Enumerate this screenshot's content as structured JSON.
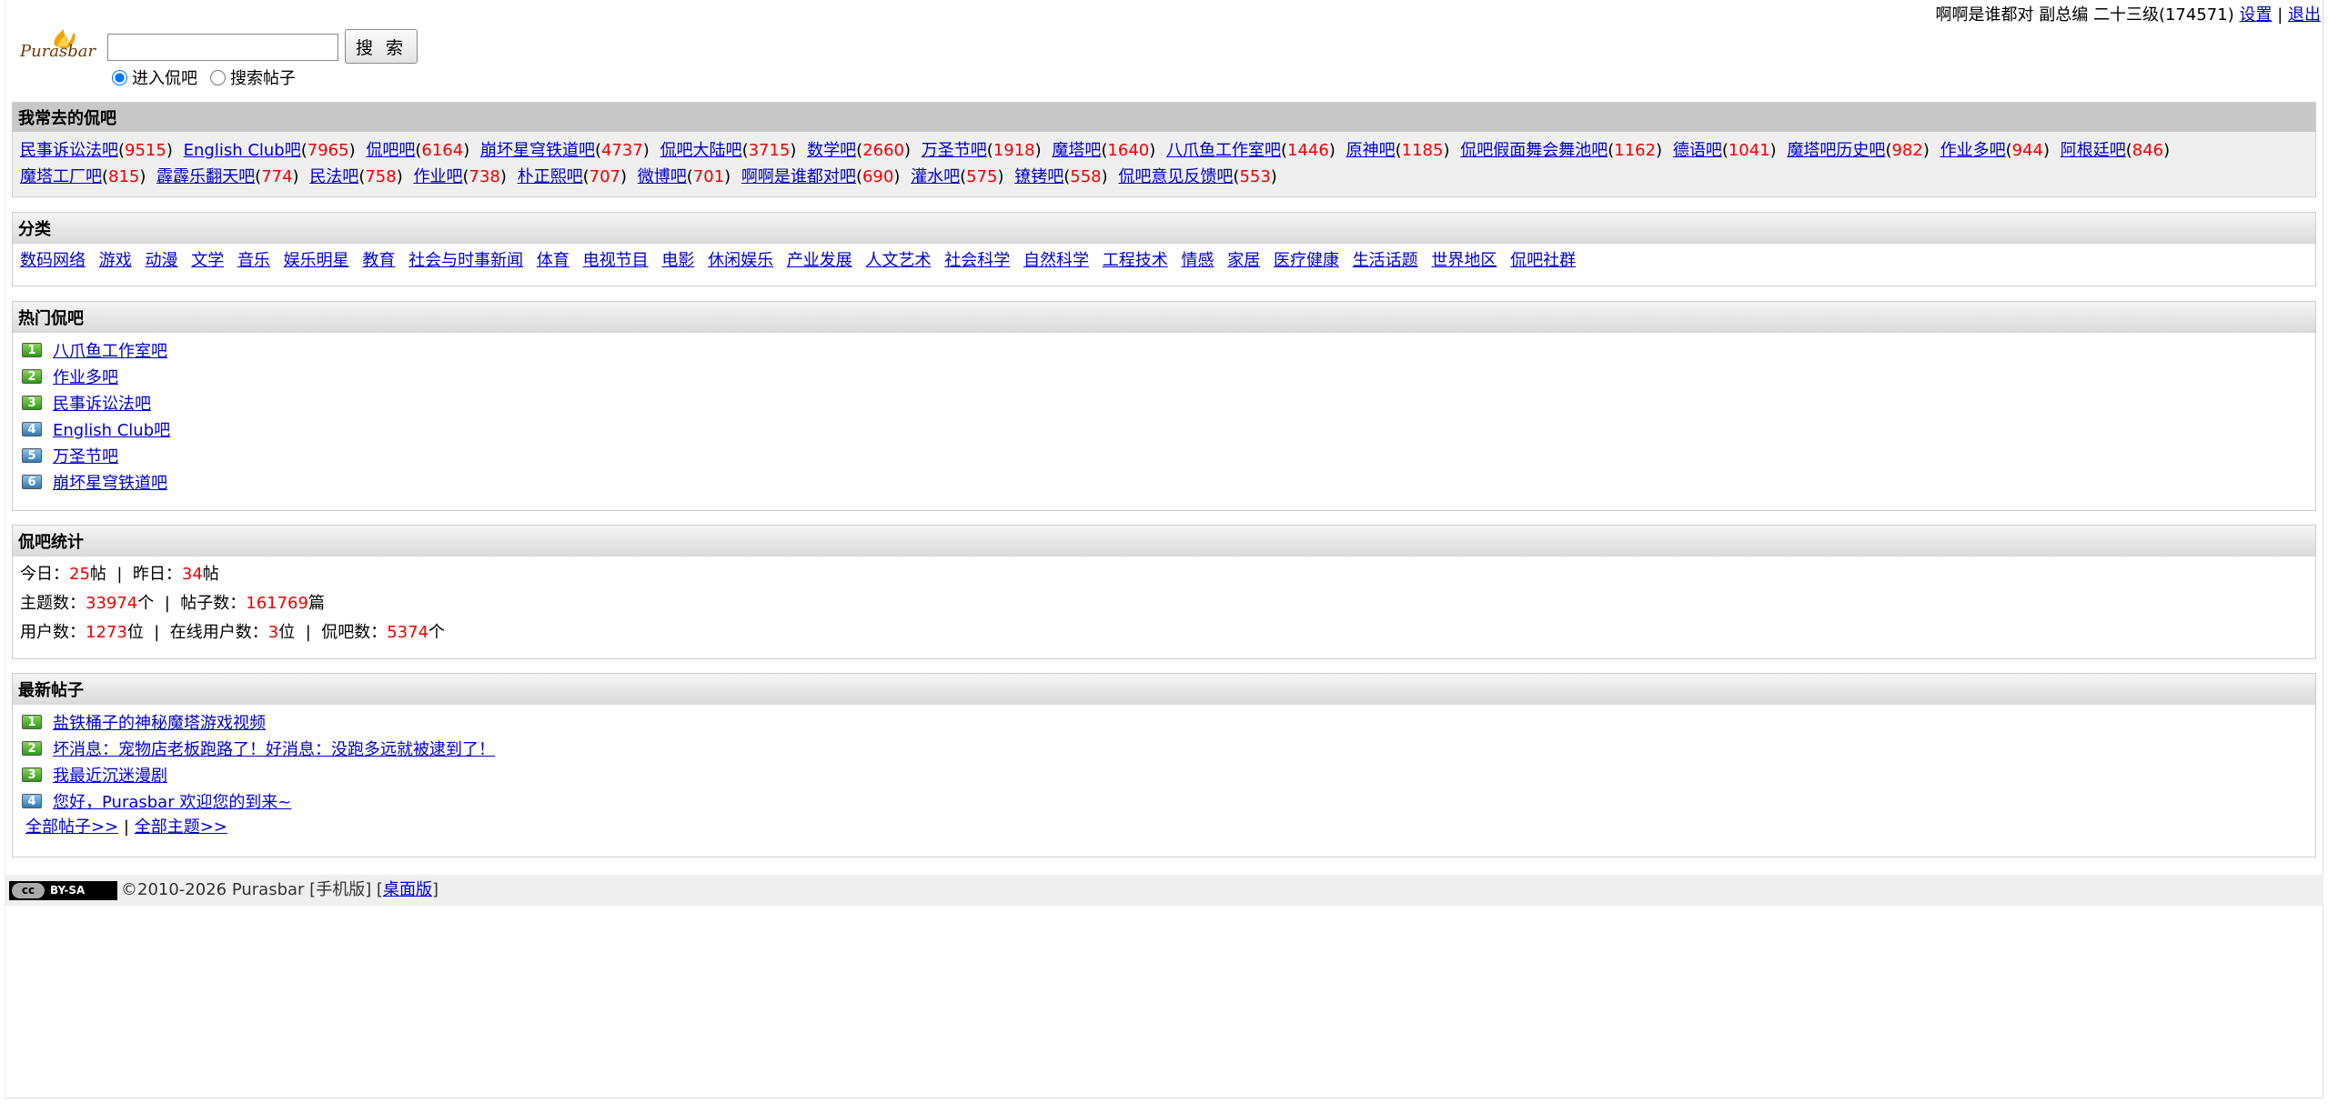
{
  "topbar": {
    "user": "啊啊是谁都对 副总编 二十三级(174571)",
    "settings": "设置",
    "sep": "|",
    "logout": "退出"
  },
  "logo": {
    "text": "Purasbar"
  },
  "search": {
    "value": "",
    "button": "搜 索",
    "radio_enter": "进入侃吧",
    "radio_search": "搜索帖子"
  },
  "fav": {
    "title": "我常去的侃吧",
    "items": [
      {
        "name": "民事诉讼法吧",
        "count": "9515"
      },
      {
        "name": "English Club吧",
        "count": "7965"
      },
      {
        "name": "侃吧吧",
        "count": "6164"
      },
      {
        "name": "崩坏星穹铁道吧",
        "count": "4737"
      },
      {
        "name": "侃吧大陆吧",
        "count": "3715"
      },
      {
        "name": "数学吧",
        "count": "2660"
      },
      {
        "name": "万圣节吧",
        "count": "1918"
      },
      {
        "name": "魔塔吧",
        "count": "1640"
      },
      {
        "name": "八爪鱼工作室吧",
        "count": "1446"
      },
      {
        "name": "原神吧",
        "count": "1185"
      },
      {
        "name": "侃吧假面舞会舞池吧",
        "count": "1162"
      },
      {
        "name": "德语吧",
        "count": "1041"
      },
      {
        "name": "魔塔吧历史吧",
        "count": "982"
      },
      {
        "name": "作业多吧",
        "count": "944"
      },
      {
        "name": "阿根廷吧",
        "count": "846"
      },
      {
        "name": "魔塔工厂吧",
        "count": "815"
      },
      {
        "name": "霹霹乐翻天吧",
        "count": "774"
      },
      {
        "name": "民法吧",
        "count": "758"
      },
      {
        "name": "作业吧",
        "count": "738"
      },
      {
        "name": "朴正熙吧",
        "count": "707"
      },
      {
        "name": "微博吧",
        "count": "701"
      },
      {
        "name": "啊啊是谁都对吧",
        "count": "690"
      },
      {
        "name": "灌水吧",
        "count": "575"
      },
      {
        "name": "镣铐吧",
        "count": "558"
      },
      {
        "name": "侃吧意见反馈吧",
        "count": "553"
      }
    ]
  },
  "categories": {
    "title": "分类",
    "items": [
      "数码网络",
      "游戏",
      "动漫",
      "文学",
      "音乐",
      "娱乐明星",
      "教育",
      "社会与时事新闻",
      "体育",
      "电视节目",
      "电影",
      "休闲娱乐",
      "产业发展",
      "人文艺术",
      "社会科学",
      "自然科学",
      "工程技术",
      "情感",
      "家居",
      "医疗健康",
      "生活话题",
      "世界地区",
      "侃吧社群"
    ]
  },
  "hot": {
    "title": "热门侃吧",
    "items": [
      {
        "rank": "1",
        "name": "八爪鱼工作室吧",
        "color": "green"
      },
      {
        "rank": "2",
        "name": "作业多吧",
        "color": "green"
      },
      {
        "rank": "3",
        "name": "民事诉讼法吧",
        "color": "green"
      },
      {
        "rank": "4",
        "name": "English Club吧",
        "color": "blue"
      },
      {
        "rank": "5",
        "name": "万圣节吧",
        "color": "blue"
      },
      {
        "rank": "6",
        "name": "崩坏星穹铁道吧",
        "color": "blue"
      }
    ]
  },
  "stats": {
    "title": "侃吧统计",
    "today_label": "今日：",
    "today": "25",
    "tie_unit": "帖",
    "yesterday_label": "昨日：",
    "yesterday": "34",
    "topics_label": "主题数：",
    "topics": "33974",
    "topics_unit": "个",
    "posts_label": "帖子数：",
    "posts": "161769",
    "posts_unit": "篇",
    "users_label": "用户数：",
    "users": "1273",
    "users_unit": "位",
    "online_label": "在线用户数：",
    "online": "3",
    "online_unit": "位",
    "bars_label": "侃吧数：",
    "bars": "5374",
    "bars_unit": "个",
    "sep": "|"
  },
  "latest": {
    "title": "最新帖子",
    "items": [
      {
        "rank": "1",
        "title": "盐铁桶子的神秘魔塔游戏视频",
        "color": "green"
      },
      {
        "rank": "2",
        "title": "坏消息：宠物店老板跑路了！好消息：没跑多远就被逮到了！",
        "color": "green"
      },
      {
        "rank": "3",
        "title": "我最近沉迷漫剧",
        "color": "green"
      },
      {
        "rank": "4",
        "title": "您好，Purasbar 欢迎您的到来~",
        "color": "blue"
      }
    ],
    "all_posts": "全部帖子>>",
    "sep": "|",
    "all_topics": "全部主题>>"
  },
  "footer": {
    "cc_left": "cc",
    "cc_right": "BY-SA",
    "text": "©2010-2026 Purasbar [手机版] [",
    "desktop": "桌面版",
    "close": "]"
  }
}
